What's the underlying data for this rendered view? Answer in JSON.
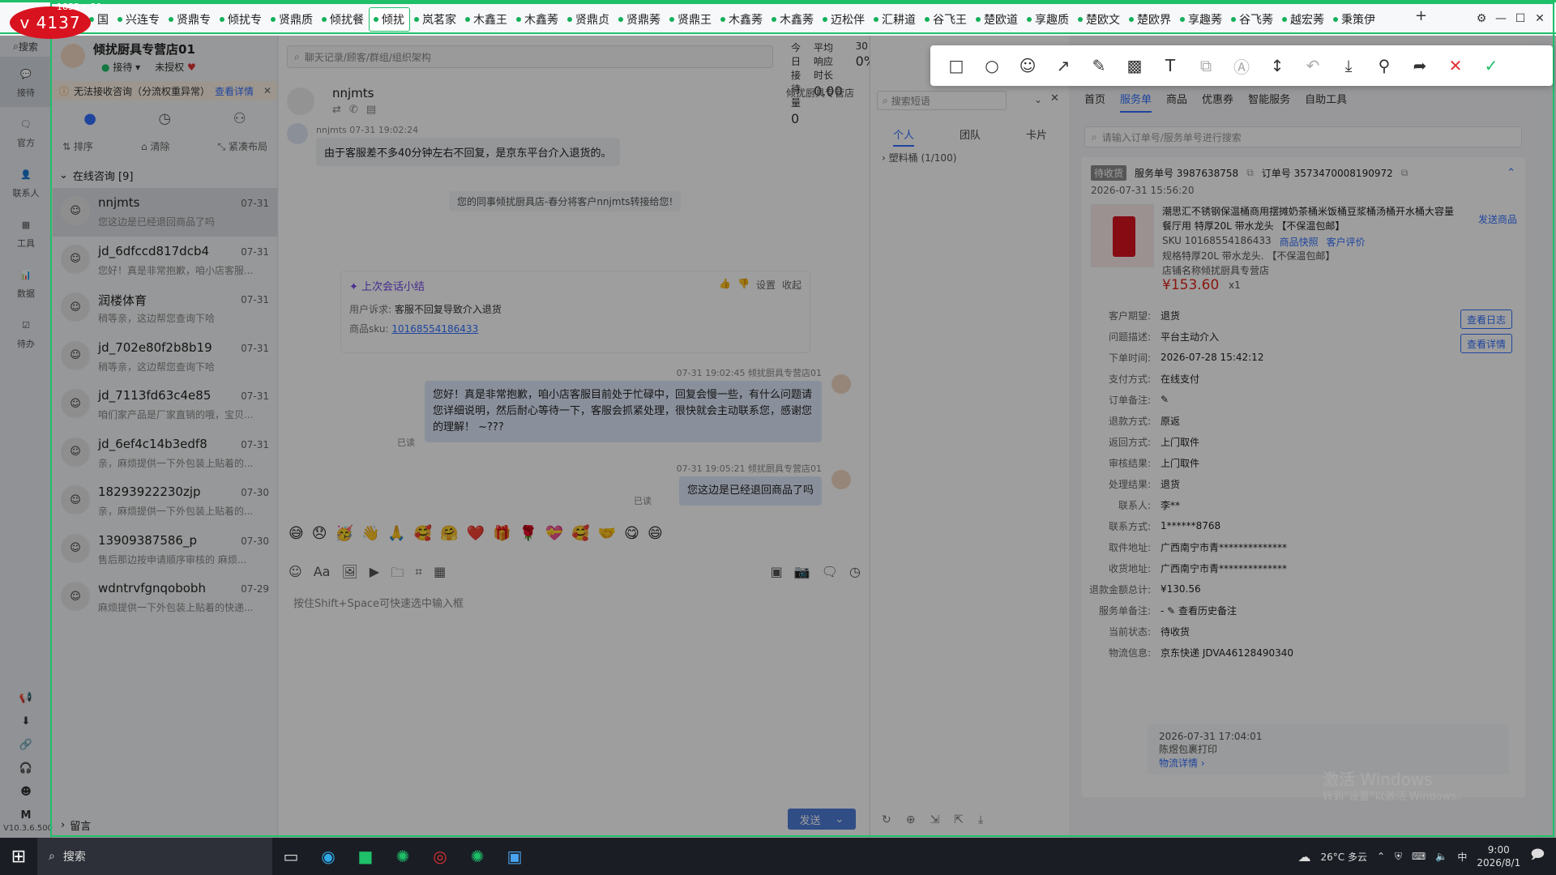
{
  "badge": {
    "text": "v 4137",
    "size_text": "1855 x 30"
  },
  "tabs": [
    "国",
    "兴连专",
    "贤鼎专",
    "倾扰专",
    "贤鼎质",
    "倾扰餐",
    "倾扰",
    "岚茗家",
    "木鑫王",
    "木鑫莠",
    "贤鼎贞",
    "贤鼎莠",
    "贤鼎王",
    "木鑫莠",
    "木鑫莠",
    "迈松伴",
    "汇耕道",
    "谷飞王",
    "楚欧道",
    "享趣质",
    "楚欧文",
    "楚欧界",
    "享趣莠",
    "谷飞莠",
    "越宏莠",
    "秉策伊"
  ],
  "active_tab_index": 6,
  "rail": {
    "search": "搜索",
    "items": [
      "接待",
      "官方",
      "联系人",
      "工具",
      "数据",
      "待办"
    ],
    "version": "V10.3.6.500"
  },
  "shop": {
    "name": "倾扰厨具专营店01",
    "status": "接待",
    "auth": "未授权"
  },
  "warning": {
    "text": "无法接收咨询（分流权重异常）",
    "link": "查看详情"
  },
  "list_tools": {
    "sort": "排序",
    "clear": "清除",
    "layout": "紧凑布局"
  },
  "group": {
    "title": "在线咨询 [9]"
  },
  "conversations": [
    {
      "name": "nnjmts",
      "date": "07-31",
      "preview": "您这边是已经退回商品了吗"
    },
    {
      "name": "jd_6dfccd817dcb4",
      "date": "07-31",
      "preview": "您好！真是非常抱歉，咱小店客服..."
    },
    {
      "name": "润楼体育",
      "date": "07-31",
      "preview": "稍等亲，这边帮您查询下哈"
    },
    {
      "name": "jd_702e80f2b8b19",
      "date": "07-31",
      "preview": "稍等亲，这边帮您查询下哈"
    },
    {
      "name": "jd_7113fd63c4e85",
      "date": "07-31",
      "preview": "咱们家产品是厂家直销的哦，宝贝..."
    },
    {
      "name": "jd_6ef4c14b3edf8",
      "date": "07-31",
      "preview": "亲，麻烦提供一下外包装上贴着的..."
    },
    {
      "name": "18293922230zjp",
      "date": "07-30",
      "preview": "亲，麻烦提供一下外包装上贴着的..."
    },
    {
      "name": "13909387586_p",
      "date": "07-30",
      "preview": "售后那边按申请顺序审核的 麻烦..."
    },
    {
      "name": "wdntrvfgnqobobh",
      "date": "07-29",
      "preview": "麻烦提供一下外包装上贴着的快递..."
    }
  ],
  "leave_msg": "留言",
  "chat": {
    "search_placeholder": "聊天记录/顾客/群组/组织架构",
    "stats": [
      {
        "label": "今日接待量",
        "value": "0"
      },
      {
        "label": "平均响应时长",
        "value": "0.00"
      },
      {
        "label": "30",
        "value": "0%"
      }
    ],
    "contact": "nnjmts",
    "shop_label": "倾扰厨具专营店",
    "msg1_meta": "nnjmts 07-31 19:02:24",
    "msg1": "由于客服差不多40分钟左右不回复，是京东平台介入退货的。",
    "sys": "您的同事倾扰厨具店-春分将客户nnjmts转接给您!",
    "summary_title": "上次会话小结",
    "summary_settings": "设置",
    "summary_collapse": "收起",
    "summary_appeal_k": "用户诉求:",
    "summary_appeal_v": "客服不回复导致介入退货",
    "summary_sku_k": "商品sku:",
    "summary_sku_v": "10168554186433",
    "msg2_meta": "07-31 19:02:45  倾扰厨具专营店01",
    "msg2": "您好！真是非常抱歉，咱小店客服目前处于忙碌中，回复会慢一些，有什么问题请您详细说明，然后耐心等待一下，客服会抓紧处理，很快就会主动联系您，感谢您的理解！ ~???",
    "read1": "已读",
    "msg3_meta": "07-31 19:05:21  倾扰厨具专营店01",
    "msg3": "您这边是已经退回商品了吗",
    "read2": "已读",
    "emojis": [
      "😅",
      "😞",
      "🥳",
      "👋",
      "🙏",
      "🥰",
      "🤗",
      "❤️",
      "🎁",
      "🌹",
      "💝",
      "🥰",
      "🤝",
      "😋",
      "😄"
    ],
    "compose_placeholder": "按住Shift+Space可快速选中输入框",
    "send": "发送"
  },
  "quick": {
    "search_placeholder": "搜索短语",
    "tabs": [
      "个人",
      "团队",
      "卡片"
    ],
    "group": "塑料桶 (1/100)"
  },
  "order": {
    "nav": [
      "首页",
      "服务单",
      "商品",
      "优惠券",
      "智能服务",
      "自助工具"
    ],
    "search_placeholder": "请输入订单号/服务单号进行搜索",
    "status_tag": "待收货",
    "service_no": "服务单号 3987638758",
    "order_no": "订单号 3573470008190972",
    "time": "2026-07-31 15:56:20",
    "product_title": "潮思汇不锈钢保温桶商用摆摊奶茶桶米饭桶豆浆桶汤桶开水桶大容量餐厅用 特厚20L 带水龙头 【不保温包邮】",
    "sku": "SKU 10168554186433",
    "snapshot": "商品快照",
    "review": "客户评价",
    "spec": "规格特厚20L 带水龙头. 【不保温包邮】",
    "store": "店铺名称倾扰厨具专营店",
    "price": "¥153.60",
    "qty": "x1",
    "send_product": "发送商品",
    "btn_log": "查看日志",
    "btn_detail": "查看详情",
    "fields": [
      {
        "k": "客户期望:",
        "v": "退货"
      },
      {
        "k": "问题描述:",
        "v": "平台主动介入"
      },
      {
        "k": "下单时间:",
        "v": "2026-07-28 15:42:12"
      },
      {
        "k": "支付方式:",
        "v": "在线支付"
      },
      {
        "k": "订单备注:",
        "v": "✎"
      },
      {
        "k": "退款方式:",
        "v": "原返"
      },
      {
        "k": "返回方式:",
        "v": "上门取件"
      },
      {
        "k": "审核结果:",
        "v": "上门取件"
      },
      {
        "k": "处理结果:",
        "v": "退货"
      },
      {
        "k": "联系人:",
        "v": "李**"
      },
      {
        "k": "联系方式:",
        "v": "1******8768"
      },
      {
        "k": "取件地址:",
        "v": "广西南宁市青**************"
      },
      {
        "k": "收货地址:",
        "v": "广西南宁市青**************"
      },
      {
        "k": "退款金额总计:",
        "v": "¥130.56"
      },
      {
        "k": "服务单备注:",
        "v": "-  ✎  查看历史备注"
      },
      {
        "k": "当前状态:",
        "v": "待收货"
      },
      {
        "k": "物流信息:",
        "v": "京东快递 JDVA46128490340"
      }
    ],
    "logistics_time": "2026-07-31 17:04:01",
    "logistics_status": "陈煜包裹打印",
    "logistics_link": "物流详情"
  },
  "activate": {
    "line1": "激活 Windows",
    "line2": "转到\"设置\"以激活 Windows。"
  },
  "taskbar": {
    "search": "搜索",
    "weather": "26°C 多云",
    "ime": "中",
    "time": "9:00",
    "date": "2026/8/1"
  }
}
